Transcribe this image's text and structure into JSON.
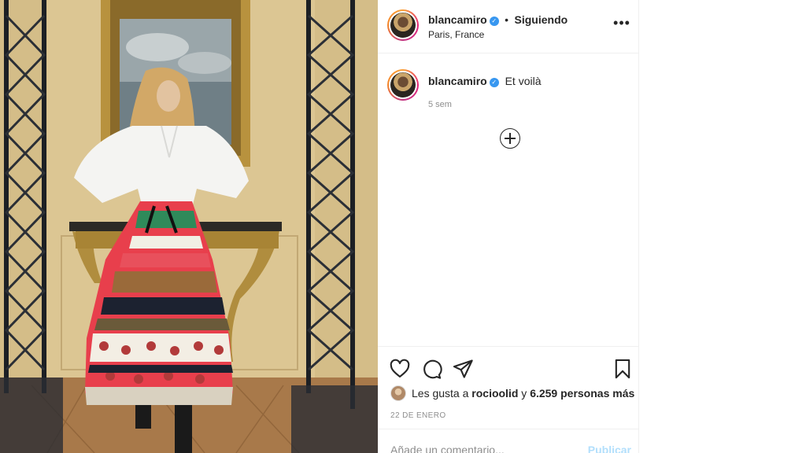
{
  "post": {
    "image_alt": "Woman in white shirt and striped embroidered skirt posing in front of a gilded console table",
    "header": {
      "username": "blancamiro",
      "separator": "•",
      "follow_status": "Siguiendo",
      "location": "Paris, France",
      "more_label": "•••"
    },
    "caption": {
      "username": "blancamiro",
      "text": "Et voilà",
      "time": "5 sem"
    },
    "actions": {
      "like_icon": "heart-icon",
      "comment_icon": "comment-icon",
      "share_icon": "paper-plane-icon",
      "save_icon": "bookmark-icon"
    },
    "likes": {
      "prefix": "Les gusta a",
      "user": "rocioolid",
      "connector": "y",
      "count_text": "6.259 personas más"
    },
    "date": "22 DE ENERO",
    "add_comment": {
      "placeholder": "Añade un comentario...",
      "publish_label": "Publicar"
    }
  },
  "colors": {
    "accent_blue": "#3897f0",
    "publish_disabled": "#b2dffc",
    "text": "#262626",
    "muted": "#8e8e8e",
    "border": "#efefef"
  }
}
